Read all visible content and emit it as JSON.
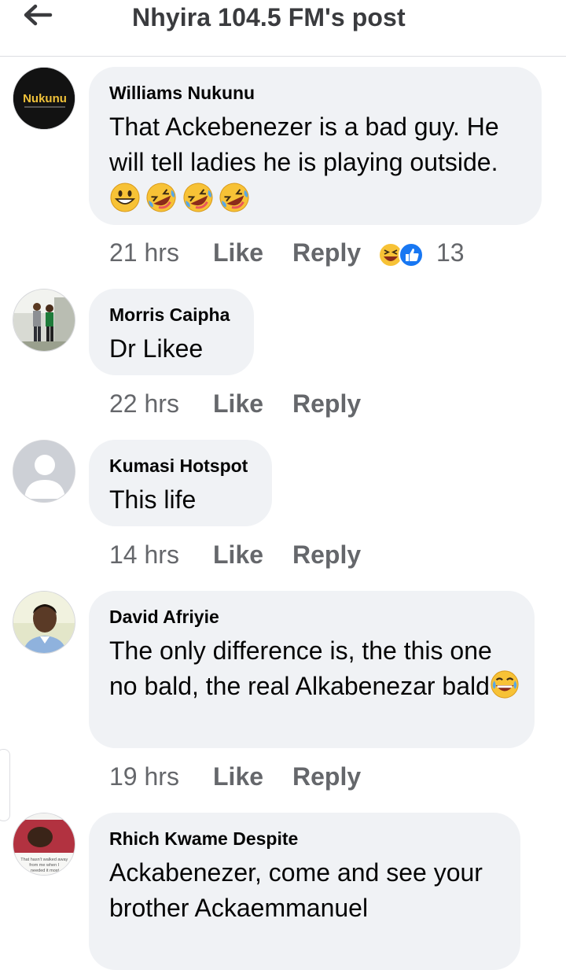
{
  "header": {
    "title": "Nhyira 104.5 FM's post"
  },
  "comments": [
    {
      "author": "Williams Nukunu",
      "avatar_text": "Nukunu",
      "text": "That Ackebenezer is a bad guy. He will tell ladies he is playing outside.",
      "emojis": [
        "grinning-face",
        "rolling-laughing-face",
        "rolling-laughing-face",
        "rolling-laughing-face"
      ],
      "time": "21 hrs",
      "like": "Like",
      "reply": "Reply",
      "reactions": [
        "haha",
        "like"
      ],
      "reaction_count": "13"
    },
    {
      "author": "Morris Caipha",
      "text": "Dr Likee",
      "time": "22 hrs",
      "like": "Like",
      "reply": "Reply"
    },
    {
      "author": "Kumasi Hotspot",
      "text": "This life",
      "time": "14 hrs",
      "like": "Like",
      "reply": "Reply"
    },
    {
      "author": "David Afriyie",
      "text": "The only difference is, the this one no bald, the real Alkabenezar bald",
      "trailing_emoji": "tears-of-joy-face",
      "time": "19 hrs",
      "like": "Like",
      "reply": "Reply"
    },
    {
      "author": "Rhich Kwame Despite",
      "text": "Ackabenezer, come and see your brother Ackaemmanuel",
      "avatar_caption": "That hasn't walked away from me when I needed it most"
    }
  ],
  "colors": {
    "bubble": "#f0f2f5",
    "meta": "#65676b",
    "like_blue": "#1877f2",
    "emoji_yellow": "#f7c236"
  }
}
